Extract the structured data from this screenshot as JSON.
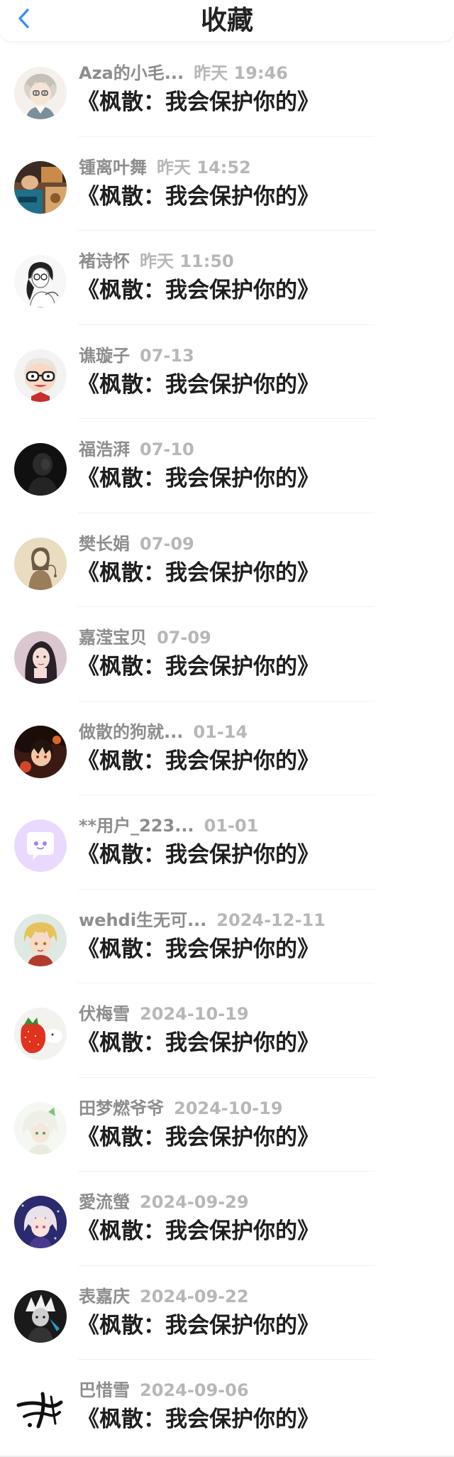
{
  "header": {
    "title": "收藏",
    "back_icon": "chevron-left-icon",
    "accent_color": "#2f8cff"
  },
  "favorites": [
    {
      "name": "Aza的小毛...",
      "time": "昨天 19:46",
      "title": "《枫散：我会保护你的》",
      "avatar_icon": "anime-avatar-silver-hair"
    },
    {
      "name": "锺离叶舞",
      "time": "昨天 14:52",
      "title": "《枫散：我会保护你的》",
      "avatar_icon": "photo-avatar-room"
    },
    {
      "name": "褚诗怀",
      "time": "昨天 11:50",
      "title": "《枫散：我会保护你的》",
      "avatar_icon": "sketch-avatar-girl"
    },
    {
      "name": "谯璇子",
      "time": "07-13",
      "title": "《枫散：我会保护你的》",
      "avatar_icon": "cartoon-avatar-glasses"
    },
    {
      "name": "福浩湃",
      "time": "07-10",
      "title": "《枫散：我会保护你的》",
      "avatar_icon": "dark-avatar-silhouette"
    },
    {
      "name": "樊长娟",
      "time": "07-09",
      "title": "《枫散：我会保护你的》",
      "avatar_icon": "drawing-avatar-sepia"
    },
    {
      "name": "嘉滢宝贝",
      "time": "07-09",
      "title": "《枫散：我会保护你的》",
      "avatar_icon": "photo-avatar-girl"
    },
    {
      "name": "做散的狗就...",
      "time": "01-14",
      "title": "《枫散：我会保护你的》",
      "avatar_icon": "anime-avatar-dark-red"
    },
    {
      "name": "**用户_223...",
      "time": "01-01",
      "title": "《枫散：我会保护你的》",
      "avatar_icon": "chat-bubble-avatar"
    },
    {
      "name": "wehdi生无可...",
      "time": "2024-12-11",
      "title": "《枫散：我会保护你的》",
      "avatar_icon": "anime-avatar-blonde"
    },
    {
      "name": "伏梅雪",
      "time": "2024-10-19",
      "title": "《枫散：我会保护你的》",
      "avatar_icon": "strawberry-avatar"
    },
    {
      "name": "田梦燃爷爷",
      "time": "2024-10-19",
      "title": "《枫散：我会保护你的》",
      "avatar_icon": "anime-avatar-green-hair"
    },
    {
      "name": "愛流螢",
      "time": "2024-09-29",
      "title": "《枫散：我会保护你的》",
      "avatar_icon": "anime-avatar-firefly"
    },
    {
      "name": "表嘉庆",
      "time": "2024-09-22",
      "title": "《枫散：我会保护你的》",
      "avatar_icon": "anime-avatar-dark-spiky"
    },
    {
      "name": "巴惜雪",
      "time": "2024-09-06",
      "title": "《枫散：我会保护你的》",
      "avatar_icon": "calligraphy-avatar"
    }
  ]
}
